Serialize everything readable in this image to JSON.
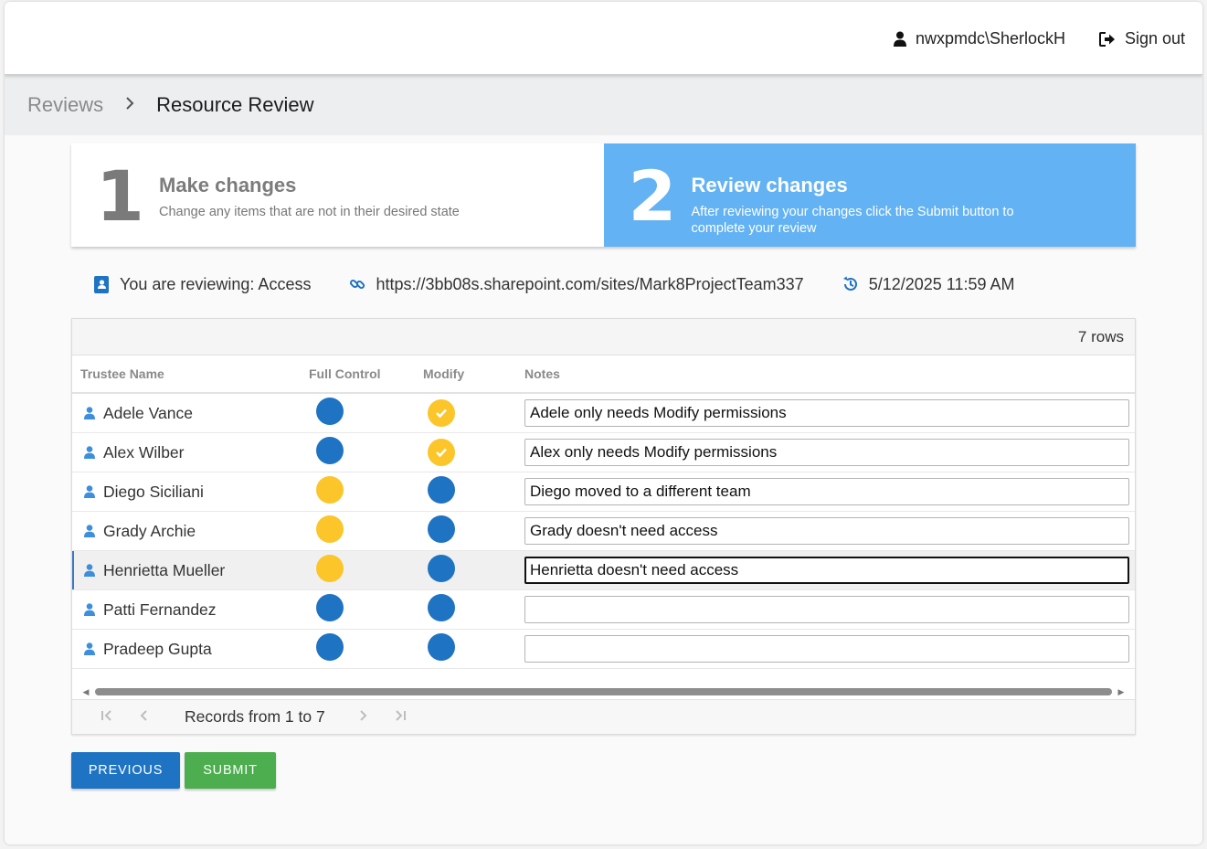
{
  "header": {
    "username": "nwxpmdc\\SherlockH",
    "sign_out_label": "Sign out"
  },
  "breadcrumb": {
    "parent": "Reviews",
    "current": "Resource Review"
  },
  "steps": [
    {
      "number": "1",
      "title": "Make changes",
      "description": "Change any items that are not in their desired state",
      "active": false
    },
    {
      "number": "2",
      "title": "Review changes",
      "description": "After reviewing your changes click the Submit button to complete your review",
      "active": true
    }
  ],
  "info": {
    "reviewing": "You are reviewing: Access",
    "url": "https://3bb08s.sharepoint.com/sites/Mark8ProjectTeam337",
    "timestamp": "5/12/2025 11:59 AM"
  },
  "grid": {
    "row_count": "7 rows",
    "columns": [
      "Trustee Name",
      "Full Control",
      "Modify",
      "Notes"
    ],
    "rows": [
      {
        "name": "Adele Vance",
        "full_control": "blue",
        "modify": "yellow-check",
        "notes": "Adele only needs Modify permissions"
      },
      {
        "name": "Alex Wilber",
        "full_control": "blue",
        "modify": "yellow-check",
        "notes": "Alex only needs Modify permissions"
      },
      {
        "name": "Diego Siciliani",
        "full_control": "yellow",
        "modify": "blue",
        "notes": "Diego moved to a different team"
      },
      {
        "name": "Grady Archie",
        "full_control": "yellow",
        "modify": "blue",
        "notes": "Grady doesn't need access"
      },
      {
        "name": "Henrietta Mueller",
        "full_control": "yellow",
        "modify": "blue",
        "notes": "Henrietta doesn't need access"
      },
      {
        "name": "Patti Fernandez",
        "full_control": "blue",
        "modify": "blue",
        "notes": ""
      },
      {
        "name": "Pradeep Gupta",
        "full_control": "blue",
        "modify": "blue",
        "notes": ""
      }
    ],
    "selected_row": 4,
    "pager_text": "Records from 1 to 7"
  },
  "buttons": {
    "previous": "PREVIOUS",
    "submit": "SUBMIT"
  },
  "colors": {
    "primary": "#1e73c3",
    "accent_yellow": "#fcc52a",
    "active_step": "#63b2f3",
    "submit": "#4cae4f"
  }
}
